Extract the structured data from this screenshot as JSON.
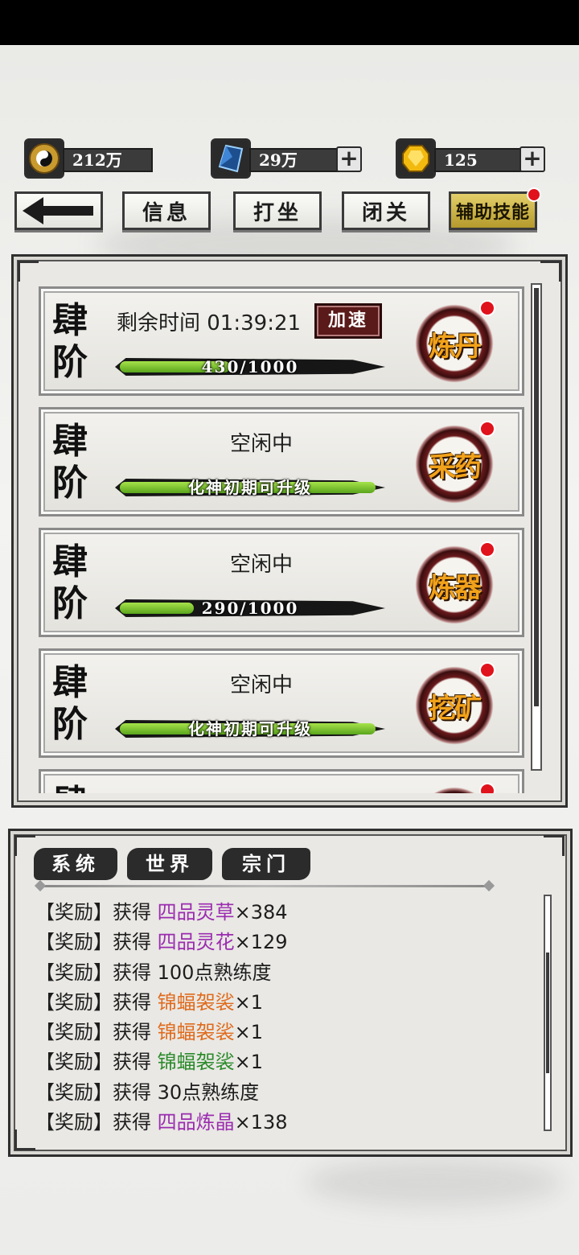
{
  "currencies": [
    {
      "icon": "yin-yang-coin-icon",
      "value": "212万",
      "has_plus": false
    },
    {
      "icon": "blue-crystal-icon",
      "value": "29万",
      "has_plus": true
    },
    {
      "icon": "gold-gem-icon",
      "value": "125",
      "has_plus": true
    }
  ],
  "nav": {
    "back_icon": "back-arrow-icon",
    "info": "信息",
    "meditate": "打坐",
    "seclusion": "闭关",
    "assist_skills": "辅助技能"
  },
  "skills": [
    {
      "rank": "肆阶",
      "status": "剩余时间 01:39:21",
      "progress_label": "430/1000",
      "progress": 0.43,
      "button": "炼丹",
      "has_speedup": true,
      "speedup_label": "加速"
    },
    {
      "rank": "肆阶",
      "status": "空闲中",
      "progress_label": "化神初期可升级",
      "progress": 1.0,
      "button": "采药",
      "has_speedup": false
    },
    {
      "rank": "肆阶",
      "status": "空闲中",
      "progress_label": "290/1000",
      "progress": 0.29,
      "button": "炼器",
      "has_speedup": false
    },
    {
      "rank": "肆阶",
      "status": "空闲中",
      "progress_label": "化神初期可升级",
      "progress": 1.0,
      "button": "挖矿",
      "has_speedup": false
    },
    {
      "rank": "肆阶",
      "status": "",
      "progress_label": "",
      "progress": 0,
      "button": "",
      "has_speedup": false
    }
  ],
  "chat": {
    "tabs": [
      "系统",
      "世界",
      "宗门"
    ],
    "logs": [
      {
        "prefix": "【奖励】获得 ",
        "item": "四品灵草",
        "suffix": "×384",
        "color": "#9b2bb0"
      },
      {
        "prefix": "【奖励】获得 ",
        "item": "四品灵花",
        "suffix": "×129",
        "color": "#9b2bb0"
      },
      {
        "prefix": "【奖励】获得 ",
        "item": "100点熟练度",
        "suffix": "",
        "color": "#1d1d1d"
      },
      {
        "prefix": "【奖励】获得 ",
        "item": "锦蝠袈裟",
        "suffix": "×1",
        "color": "#e06a1c"
      },
      {
        "prefix": "【奖励】获得 ",
        "item": "锦蝠袈裟",
        "suffix": "×1",
        "color": "#e06a1c"
      },
      {
        "prefix": "【奖励】获得 ",
        "item": "锦蝠袈裟",
        "suffix": "×1",
        "color": "#2a8a2a"
      },
      {
        "prefix": "【奖励】获得 ",
        "item": "30点熟练度",
        "suffix": "",
        "color": "#1d1d1d"
      },
      {
        "prefix": "【奖励】获得 ",
        "item": "四品炼晶",
        "suffix": "×138",
        "color": "#9b2bb0"
      }
    ]
  }
}
